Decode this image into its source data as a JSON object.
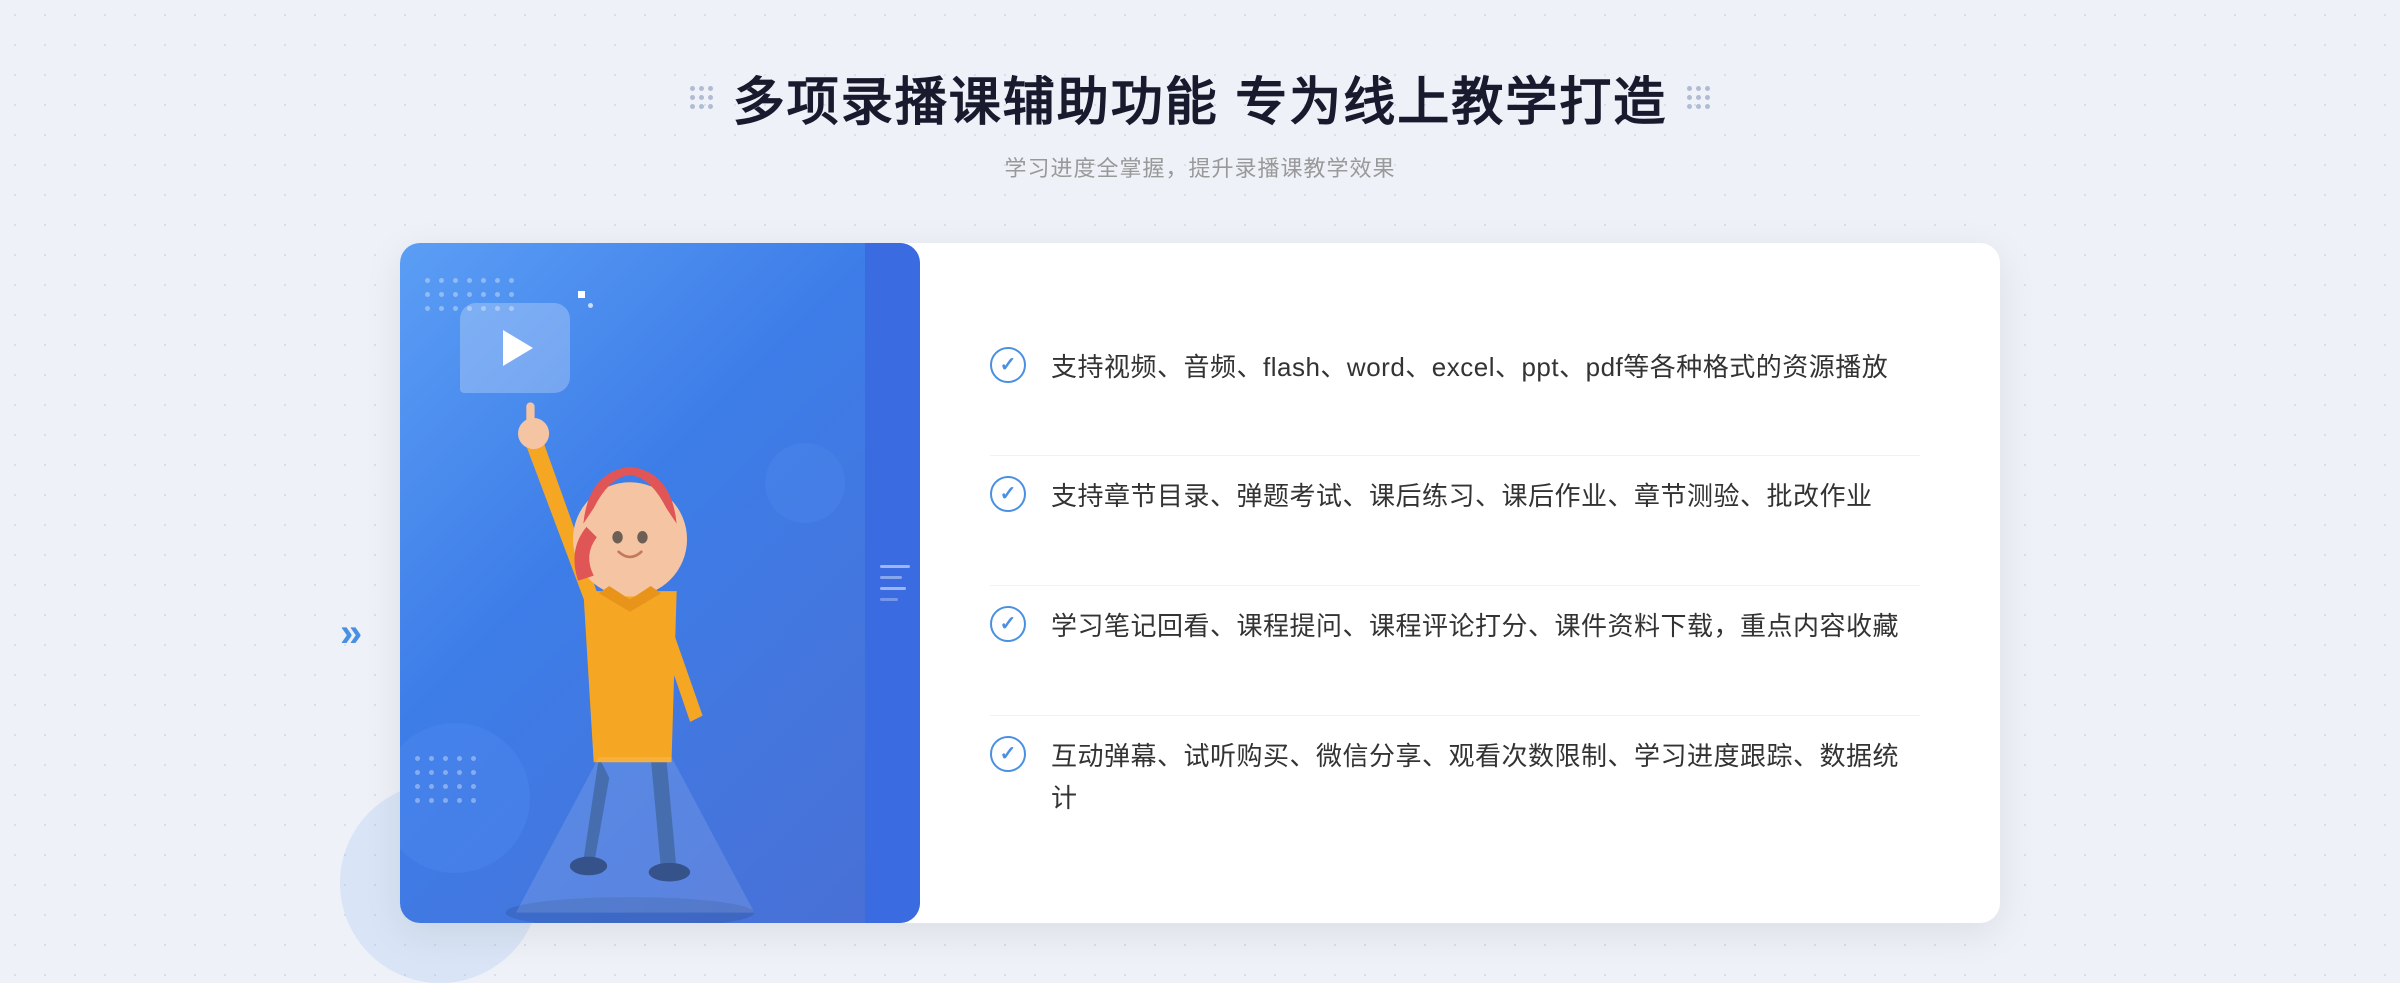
{
  "header": {
    "title": "多项录播课辅助功能 专为线上教学打造",
    "subtitle": "学习进度全掌握，提升录播课教学效果"
  },
  "features": [
    {
      "id": "feature-1",
      "text": "支持视频、音频、flash、word、excel、ppt、pdf等各种格式的资源播放"
    },
    {
      "id": "feature-2",
      "text": "支持章节目录、弹题考试、课后练习、课后作业、章节测验、批改作业"
    },
    {
      "id": "feature-3",
      "text": "学习笔记回看、课程提问、课程评论打分、课件资料下载，重点内容收藏"
    },
    {
      "id": "feature-4",
      "text": "互动弹幕、试听购买、微信分享、观看次数限制、学习进度跟踪、数据统计"
    }
  ],
  "decoration": {
    "left_chevrons": "«",
    "dots_label": "decorative-dots"
  }
}
